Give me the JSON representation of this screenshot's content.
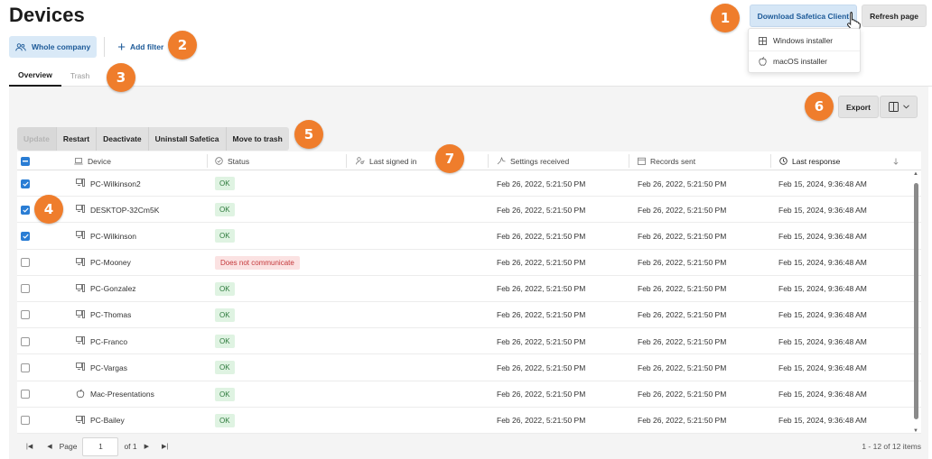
{
  "page": {
    "title": "Devices"
  },
  "top_actions": {
    "download_label": "Download Safetica Client",
    "refresh_label": "Refresh page"
  },
  "download_menu": [
    {
      "label": "Windows installer",
      "icon": "windows-icon"
    },
    {
      "label": "macOS installer",
      "icon": "apple-icon"
    }
  ],
  "filters": {
    "company_label": "Whole company",
    "add_filter_label": "Add filter"
  },
  "tabs": [
    {
      "label": "Overview",
      "active": true
    },
    {
      "label": "Trash",
      "active": false
    }
  ],
  "toolbar": {
    "export_label": "Export"
  },
  "bulk_actions": [
    {
      "label": "Update",
      "disabled": true
    },
    {
      "label": "Restart",
      "disabled": false
    },
    {
      "label": "Deactivate",
      "disabled": false
    },
    {
      "label": "Uninstall Safetica",
      "disabled": false
    },
    {
      "label": "Move to trash",
      "disabled": false
    }
  ],
  "table": {
    "columns": [
      "Device",
      "Status",
      "Last signed in",
      "Settings received",
      "Records sent",
      "Last response"
    ],
    "rows": [
      {
        "checked": true,
        "device": "PC-Wilkinson2",
        "type": "pc",
        "status": "OK",
        "status_kind": "ok",
        "last_signed_in": "",
        "settings_received": "Feb 26, 2022, 5:21:50 PM",
        "records_sent": "Feb 26, 2022, 5:21:50 PM",
        "last_response": "Feb 15, 2024, 9:36:48 AM"
      },
      {
        "checked": true,
        "device": "DESKTOP-32Cm5K",
        "type": "pc",
        "status": "OK",
        "status_kind": "ok",
        "last_signed_in": "",
        "settings_received": "Feb 26, 2022, 5:21:50 PM",
        "records_sent": "Feb 26, 2022, 5:21:50 PM",
        "last_response": "Feb 15, 2024, 9:36:48 AM"
      },
      {
        "checked": true,
        "device": "PC-Wilkinson",
        "type": "pc",
        "status": "OK",
        "status_kind": "ok",
        "last_signed_in": "",
        "settings_received": "Feb 26, 2022, 5:21:50 PM",
        "records_sent": "Feb 26, 2022, 5:21:50 PM",
        "last_response": "Feb 15, 2024, 9:36:48 AM"
      },
      {
        "checked": false,
        "device": "PC-Mooney",
        "type": "pc",
        "status": "Does not communicate",
        "status_kind": "bad",
        "last_signed_in": "",
        "settings_received": "Feb 26, 2022, 5:21:50 PM",
        "records_sent": "Feb 26, 2022, 5:21:50 PM",
        "last_response": "Feb 15, 2024, 9:36:48 AM"
      },
      {
        "checked": false,
        "device": "PC-Gonzalez",
        "type": "pc",
        "status": "OK",
        "status_kind": "ok",
        "last_signed_in": "",
        "settings_received": "Feb 26, 2022, 5:21:50 PM",
        "records_sent": "Feb 26, 2022, 5:21:50 PM",
        "last_response": "Feb 15, 2024, 9:36:48 AM"
      },
      {
        "checked": false,
        "device": "PC-Thomas",
        "type": "pc",
        "status": "OK",
        "status_kind": "ok",
        "last_signed_in": "",
        "settings_received": "Feb 26, 2022, 5:21:50 PM",
        "records_sent": "Feb 26, 2022, 5:21:50 PM",
        "last_response": "Feb 15, 2024, 9:36:48 AM"
      },
      {
        "checked": false,
        "device": "PC-Franco",
        "type": "pc",
        "status": "OK",
        "status_kind": "ok",
        "last_signed_in": "",
        "settings_received": "Feb 26, 2022, 5:21:50 PM",
        "records_sent": "Feb 26, 2022, 5:21:50 PM",
        "last_response": "Feb 15, 2024, 9:36:48 AM"
      },
      {
        "checked": false,
        "device": "PC-Vargas",
        "type": "pc",
        "status": "OK",
        "status_kind": "ok",
        "last_signed_in": "",
        "settings_received": "Feb 26, 2022, 5:21:50 PM",
        "records_sent": "Feb 26, 2022, 5:21:50 PM",
        "last_response": "Feb 15, 2024, 9:36:48 AM"
      },
      {
        "checked": false,
        "device": "Mac-Presentations",
        "type": "mac",
        "status": "OK",
        "status_kind": "ok",
        "last_signed_in": "",
        "settings_received": "Feb 26, 2022, 5:21:50 PM",
        "records_sent": "Feb 26, 2022, 5:21:50 PM",
        "last_response": "Feb 15, 2024, 9:36:48 AM"
      },
      {
        "checked": false,
        "device": "PC-Bailey",
        "type": "pc",
        "status": "OK",
        "status_kind": "ok",
        "last_signed_in": "",
        "settings_received": "Feb 26, 2022, 5:21:50 PM",
        "records_sent": "Feb 26, 2022, 5:21:50 PM",
        "last_response": "Feb 15, 2024, 9:36:48 AM"
      }
    ]
  },
  "pagination": {
    "page_label": "Page",
    "page_value": "1",
    "of_label": "of 1",
    "info": "1 - 12 of 12 items"
  },
  "callouts": [
    "1",
    "2",
    "3",
    "4",
    "5",
    "6",
    "7"
  ],
  "colors": {
    "accent": "#1d5a98",
    "callout": "#ef7d2c",
    "checkbox": "#2a7dd4",
    "ok": "#2d7a3c",
    "error": "#c4383b"
  }
}
